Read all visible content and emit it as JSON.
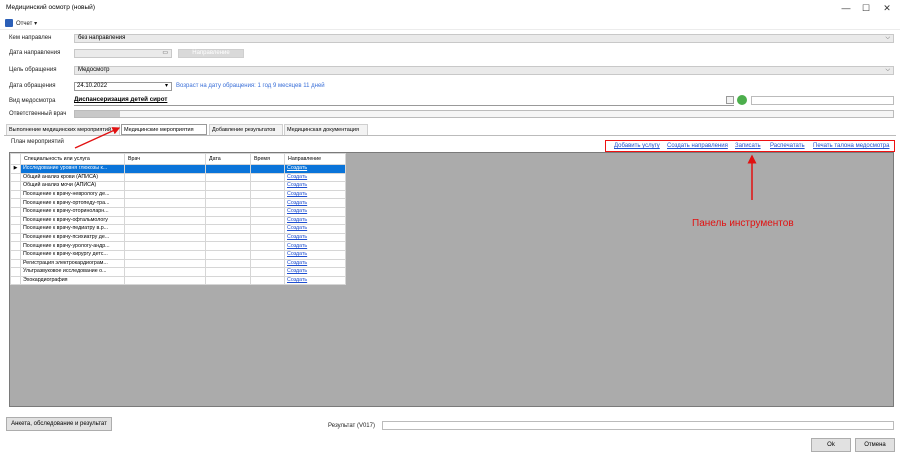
{
  "window": {
    "title": "Медицинский осмотр (новый)",
    "min": "—",
    "max": "☐",
    "close": "✕"
  },
  "menu": {
    "report_label": "Отчет ▾"
  },
  "form": {
    "referred_by": {
      "label": "Кем направлен",
      "value": "без направления"
    },
    "referral_date": {
      "label": "Дата направления",
      "button": "Направление"
    },
    "purpose": {
      "label": "Цель обращения",
      "value": "Медосмотр"
    },
    "visit_date": {
      "label": "Дата обращения",
      "value": "24.10.2022",
      "age_note": "Возраст на дату обращения: 1 год 9 месяцев 11 дней"
    },
    "exam_type": {
      "label": "Вид медосмотра",
      "value": "Диспансеризация детей сирот"
    },
    "doctor": {
      "label": "Ответственный врач"
    }
  },
  "tabs": [
    {
      "label": "Выполнение медицинских мероприятий"
    },
    {
      "label": "Медицинские мероприятия"
    },
    {
      "label": "Добавление результатов"
    },
    {
      "label": "Медицинская документация"
    }
  ],
  "plan_label": "План мероприятий",
  "toolbar": {
    "links": [
      "Добавить услугу",
      "Создать направления",
      "Записать",
      "Распечатать",
      "Печать талона медосмотра"
    ],
    "annotation": "Панель инструментов"
  },
  "table": {
    "columns": [
      "Специальность или услуга",
      "Врач",
      "Дата",
      "Время",
      "Направление"
    ],
    "rows": [
      {
        "service": "Исследование уровня глюкозы к...",
        "action": "Создать"
      },
      {
        "service": "Общий анализ крови (АПИСА)",
        "action": "Создать"
      },
      {
        "service": "Общий анализ мочи (АПИСА)",
        "action": "Создать"
      },
      {
        "service": "Посещение к врачу-неврологу де...",
        "action": "Создать"
      },
      {
        "service": "Посещение к врачу-ортопеду-тра...",
        "action": "Создать"
      },
      {
        "service": "Посещение к врачу-оториноларн...",
        "action": "Создать"
      },
      {
        "service": "Посещение к врачу-офтальмологу",
        "action": "Создать"
      },
      {
        "service": "Посещение к врачу-педиатру в.р...",
        "action": "Создать"
      },
      {
        "service": "Посещение к врачу-психиатру де...",
        "action": "Создать"
      },
      {
        "service": "Посещение к врачу-урологу-андр...",
        "action": "Создать"
      },
      {
        "service": "Посещение к врачу-хирургу детс...",
        "action": "Создать"
      },
      {
        "service": "Регистрация электрокардиограм...",
        "action": "Создать"
      },
      {
        "service": "Ультразвуковое исследование о...",
        "action": "Создать"
      },
      {
        "service": "Эхокардиография",
        "action": "Создать"
      }
    ]
  },
  "bottom": {
    "survey_button": "Анкета, обследование и результат",
    "result_label": "Результат (V017)",
    "ok": "Ok",
    "cancel": "Отмена"
  },
  "colors": {
    "accent": "#0a74d9",
    "annotation": "#e11111",
    "link": "#1f4fd1"
  }
}
